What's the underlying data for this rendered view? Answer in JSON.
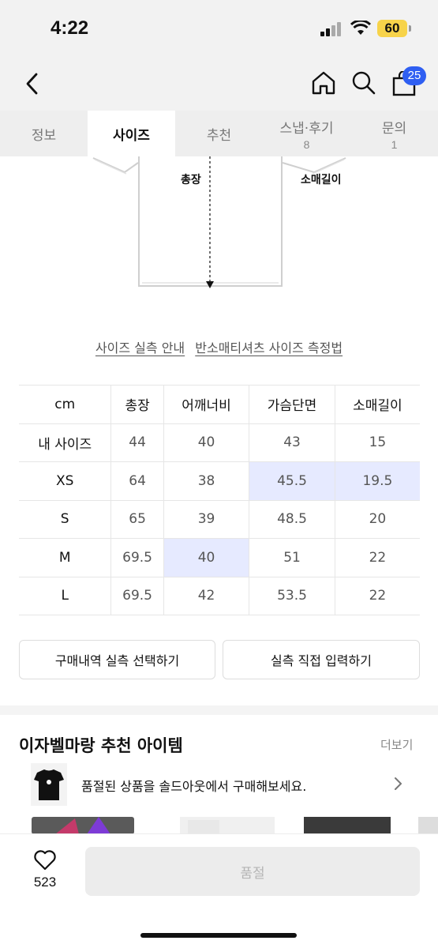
{
  "status_bar": {
    "time": "4:22",
    "battery": "60"
  },
  "nav": {
    "back_icon": "chevron-left-icon",
    "home_icon": "home-icon",
    "search_icon": "search-icon",
    "cart_icon": "shopping-bag-icon",
    "cart_count": "25"
  },
  "tabs": [
    {
      "label": "정보",
      "count": ""
    },
    {
      "label": "사이즈",
      "count": "",
      "active": true
    },
    {
      "label": "추천",
      "count": ""
    },
    {
      "label": "스냅·후기",
      "count": "8"
    },
    {
      "label": "문의",
      "count": "1"
    }
  ],
  "diagram": {
    "total_length_label": "총장",
    "sleeve_length_label": "소매길이"
  },
  "guide_links": {
    "size_guide": "사이즈 실측 안내",
    "measure_guide": "반소매티셔츠 사이즈 측정법"
  },
  "size_table": {
    "headers": [
      "cm",
      "총장",
      "어깨너비",
      "가슴단면",
      "소매길이"
    ],
    "rows": [
      [
        "내 사이즈",
        "44",
        "40",
        "43",
        "15"
      ],
      [
        "XS",
        "64",
        "38",
        "45.5",
        "19.5"
      ],
      [
        "S",
        "65",
        "39",
        "48.5",
        "20"
      ],
      [
        "M",
        "69.5",
        "40",
        "51",
        "22"
      ],
      [
        "L",
        "69.5",
        "42",
        "53.5",
        "22"
      ]
    ],
    "highlight_color": "#e6eaff"
  },
  "actions": {
    "select_purchase": "구매내역 실측 선택하기",
    "direct_input": "실측 직접 입력하기"
  },
  "recommend": {
    "title": "이자벨마랑 추천 아이템",
    "more": "더보기"
  },
  "toast": {
    "text": "품절된 상품을 솔드아웃에서 구매해보세요.",
    "arrow_icon": "chevron-right-icon"
  },
  "bottom": {
    "like_icon": "heart-icon",
    "like_count": "523",
    "buy_label": "품절"
  },
  "colors": {
    "accent": "#2f5ff2",
    "battery": "#f7d34a",
    "tab_bg": "#eeeeee"
  }
}
